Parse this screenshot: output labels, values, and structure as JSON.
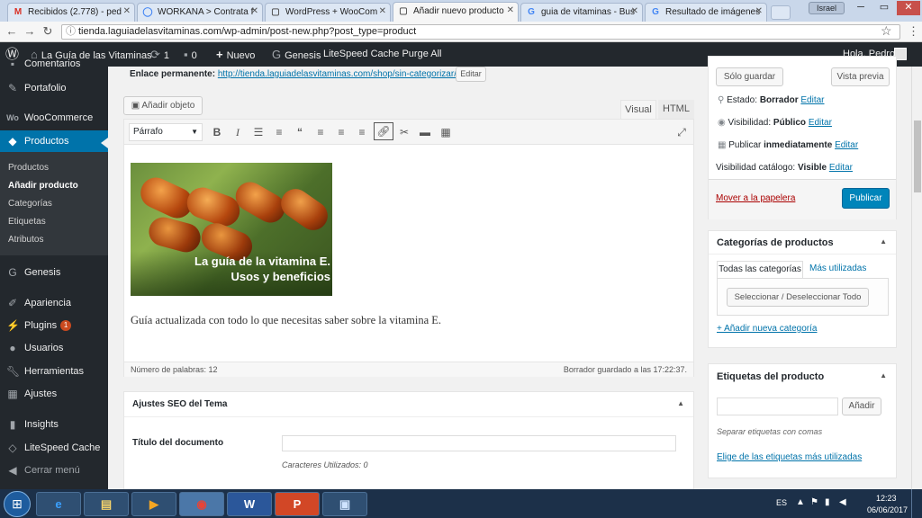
{
  "browser": {
    "tabs": [
      {
        "icon": "M",
        "icon_color": "#d93025",
        "label": "Recibidos (2.778) - ped"
      },
      {
        "icon": "◯",
        "icon_color": "#4285f4",
        "label": "WORKANA > Contrata f"
      },
      {
        "icon": "▢",
        "icon_color": "#555555",
        "label": "WordPress + WooCom"
      },
      {
        "icon": "▢",
        "icon_color": "#555555",
        "label": "Añadir nuevo producto"
      },
      {
        "icon": "G",
        "icon_color": "#4285f4",
        "label": "guia de vitaminas - Bus"
      },
      {
        "icon": "G",
        "icon_color": "#4285f4",
        "label": "Resultado de imágenes"
      }
    ],
    "user_label": "Israel",
    "url": "tienda.laguiadelasvitaminas.com/wp-admin/post-new.php?post_type=product"
  },
  "adminbar": {
    "site_name": "La Guía de las Vitaminas",
    "updates": "1",
    "comments": "0",
    "new_label": "Nuevo",
    "genesis_label": "Genesis",
    "litespeed_label": "LiteSpeed Cache Purge All",
    "greeting": "Hola, Pedro"
  },
  "sidebar": {
    "items": [
      {
        "label": "Comentarios",
        "icon": "comment-icon"
      },
      {
        "label": "Portafolio",
        "icon": "pin-icon"
      },
      {
        "label": "WooCommerce",
        "icon": "woocommerce-icon"
      },
      {
        "label": "Productos",
        "icon": "box-icon"
      },
      {
        "label": "Genesis",
        "icon": "genesis-icon"
      },
      {
        "label": "Apariencia",
        "icon": "brush-icon"
      },
      {
        "label": "Plugins",
        "icon": "plugin-icon",
        "badge": "1"
      },
      {
        "label": "Usuarios",
        "icon": "user-icon"
      },
      {
        "label": "Herramientas",
        "icon": "wrench-icon"
      },
      {
        "label": "Ajustes",
        "icon": "settings-icon"
      },
      {
        "label": "Insights",
        "icon": "insights-icon"
      },
      {
        "label": "LiteSpeed Cache",
        "icon": "diamond-icon"
      },
      {
        "label": "Cerrar menú",
        "icon": "collapse-icon"
      }
    ],
    "submenu": [
      "Productos",
      "Añadir producto",
      "Categorías",
      "Etiquetas",
      "Atributos"
    ]
  },
  "editor": {
    "permalink_label": "Enlace permanente:",
    "permalink_url": "http://tienda.laguiadelasvitaminas.com/shop/sin-categorizar/v/",
    "edit_button": "Editar",
    "add_media": "Añadir objeto",
    "tab_visual": "Visual",
    "tab_html": "HTML",
    "format_select": "Párrafo",
    "image_caption_line1": "La guía de la vitamina E.",
    "image_caption_line2": "Usos y beneficios",
    "body_text": "Guía actualizada con todo lo que necesitas saber sobre la vitamina E.",
    "word_count": "Número de palabras: 12",
    "draft_saved": "Borrador guardado a las 17:22:37."
  },
  "seo": {
    "title": "Ajustes SEO del Tema",
    "doc_title_label": "Título del documento",
    "chars_used": "Caracteres Utilizados: 0"
  },
  "publish": {
    "save_draft": "Sólo guardar",
    "preview": "Vista previa",
    "status_label": "Estado:",
    "status_value": "Borrador",
    "visibility_label": "Visibilidad:",
    "visibility_value": "Público",
    "publish_label": "Publicar",
    "publish_value": "inmediatamente",
    "catalog_label": "Visibilidad catálogo:",
    "catalog_value": "Visible",
    "edit": "Editar",
    "trash": "Mover a la papelera",
    "publish_button": "Publicar"
  },
  "categories": {
    "title": "Categorías de productos",
    "tab_all": "Todas las categorías",
    "tab_used": "Más utilizadas",
    "toggle_button": "Seleccionar / Deseleccionar Todo",
    "add_new": "+ Añadir nueva categoría"
  },
  "tags": {
    "title": "Etiquetas del producto",
    "add_button": "Añadir",
    "hint": "Separar etiquetas con comas",
    "choose": "Elige de las etiquetas más utilizadas"
  },
  "taskbar": {
    "lang": "ES",
    "time": "12:23",
    "date": "06/06/2017"
  }
}
